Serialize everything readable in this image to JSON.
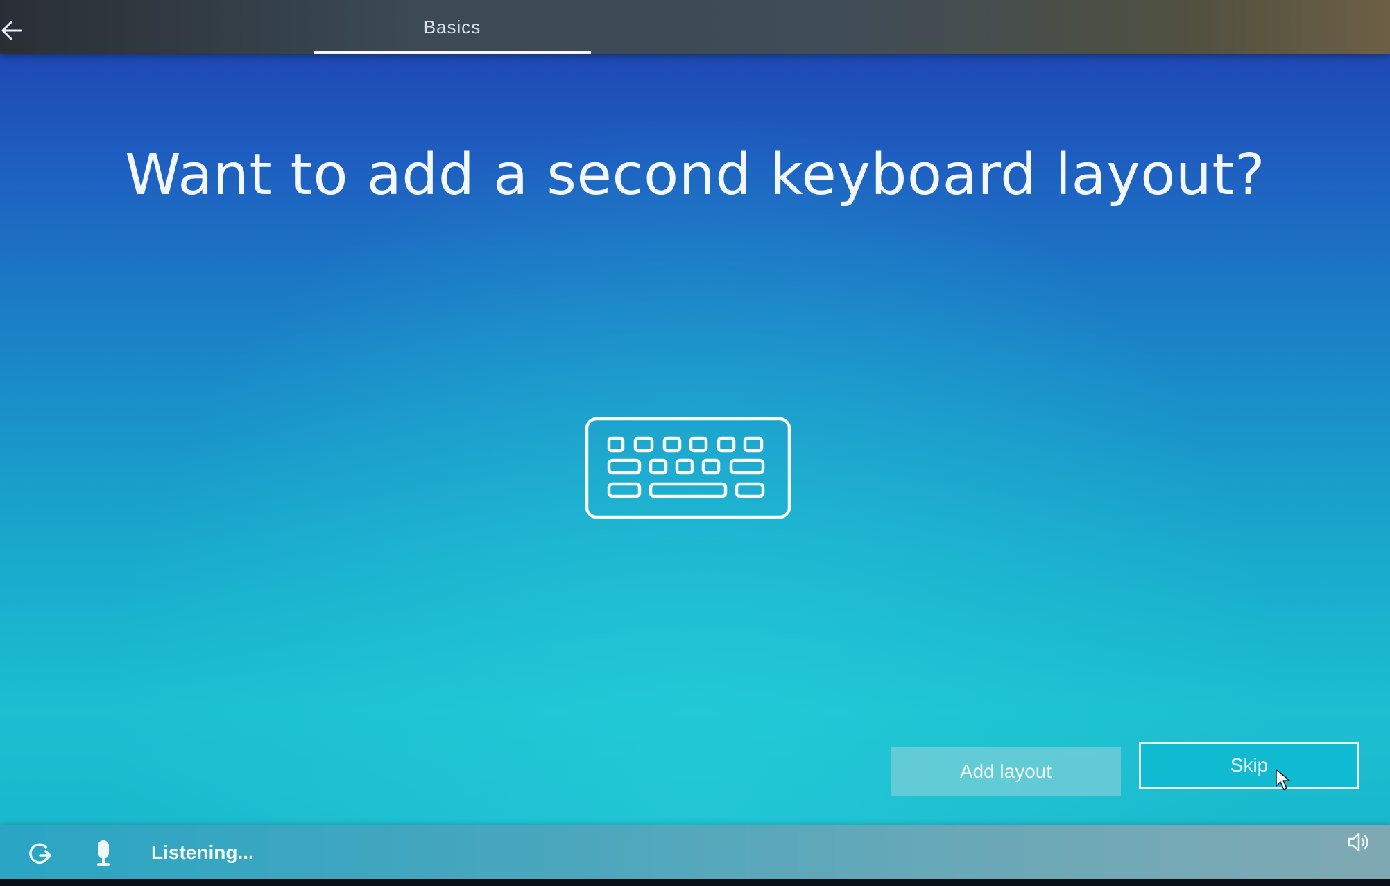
{
  "topbar": {
    "back_icon": "back-arrow-icon",
    "tab_label": "Basics"
  },
  "main": {
    "title": "Want to add a second keyboard layout?",
    "illustration_icon": "keyboard-icon"
  },
  "actions": {
    "add_layout_label": "Add layout",
    "skip_label": "Skip"
  },
  "bottombar": {
    "ease_of_access_icon": "ease-of-access-icon",
    "microphone_icon": "microphone-icon",
    "status_text": "Listening...",
    "volume_icon": "volume-icon"
  },
  "colors": {
    "accent": "#10bad0",
    "title_text": "#f2f7fb",
    "background_top": "#1f3fae",
    "background_bottom": "#1bbfd0"
  }
}
